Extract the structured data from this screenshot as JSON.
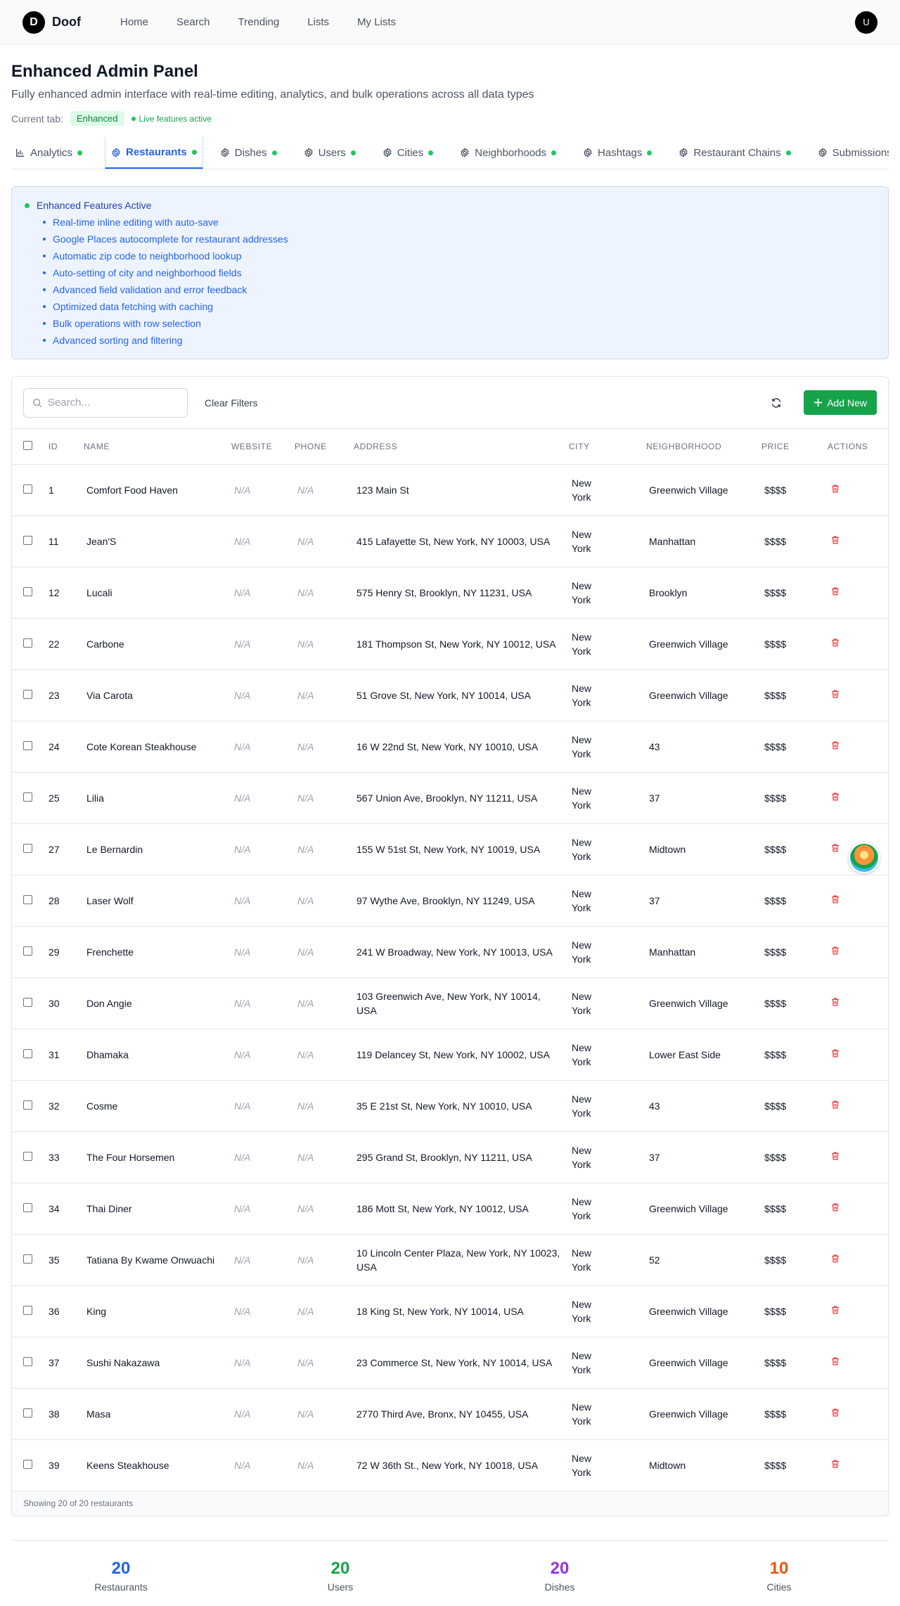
{
  "nav": {
    "logo_letter": "D",
    "brand": "Doof",
    "links": [
      "Home",
      "Search",
      "Trending",
      "Lists",
      "My Lists"
    ],
    "avatar_letter": "U"
  },
  "header": {
    "title": "Enhanced Admin Panel",
    "subtitle": "Fully enhanced admin interface with real-time editing, analytics, and bulk operations across all data types",
    "current_tab_label": "Current tab:",
    "current_tab_badge": "Enhanced",
    "live_label": "Live features active"
  },
  "tabs": [
    {
      "label": "Analytics",
      "icon": "chart-icon",
      "active": false
    },
    {
      "label": "Restaurants",
      "icon": "gear-icon",
      "active": true
    },
    {
      "label": "Dishes",
      "icon": "gear-icon",
      "active": false
    },
    {
      "label": "Users",
      "icon": "gear-icon",
      "active": false
    },
    {
      "label": "Cities",
      "icon": "gear-icon",
      "active": false
    },
    {
      "label": "Neighborhoods",
      "icon": "gear-icon",
      "active": false
    },
    {
      "label": "Hashtags",
      "icon": "gear-icon",
      "active": false
    },
    {
      "label": "Restaurant Chains",
      "icon": "gear-icon",
      "active": false
    },
    {
      "label": "Submissions",
      "icon": "gear-icon",
      "active": false
    }
  ],
  "features": {
    "title": "Enhanced Features Active",
    "items": [
      "Real-time inline editing with auto-save",
      "Google Places autocomplete for restaurant addresses",
      "Automatic zip code to neighborhood lookup",
      "Auto-setting of city and neighborhood fields",
      "Advanced field validation and error feedback",
      "Optimized data fetching with caching",
      "Bulk operations with row selection",
      "Advanced sorting and filtering"
    ]
  },
  "toolbar": {
    "search_placeholder": "Search...",
    "clear_filters": "Clear Filters",
    "add_new": "Add New"
  },
  "table": {
    "headers": [
      "ID",
      "NAME",
      "WEBSITE",
      "PHONE",
      "ADDRESS",
      "CITY",
      "NEIGHBORHOOD",
      "PRICE",
      "ACTIONS"
    ],
    "rows": [
      {
        "id": "1",
        "name": "Comfort Food Haven",
        "website": "N/A",
        "phone": "N/A",
        "address": "123 Main St",
        "city": "New York",
        "neighborhood": "Greenwich Village",
        "price": "$$$$"
      },
      {
        "id": "11",
        "name": "Jean'S",
        "website": "N/A",
        "phone": "N/A",
        "address": "415 Lafayette St, New York, NY 10003, USA",
        "city": "New York",
        "neighborhood": "Manhattan",
        "price": "$$$$"
      },
      {
        "id": "12",
        "name": "Lucali",
        "website": "N/A",
        "phone": "N/A",
        "address": "575 Henry St, Brooklyn, NY 11231, USA",
        "city": "New York",
        "neighborhood": "Brooklyn",
        "price": "$$$$"
      },
      {
        "id": "22",
        "name": "Carbone",
        "website": "N/A",
        "phone": "N/A",
        "address": "181 Thompson St, New York, NY 10012, USA",
        "city": "New York",
        "neighborhood": "Greenwich Village",
        "price": "$$$$"
      },
      {
        "id": "23",
        "name": "Via Carota",
        "website": "N/A",
        "phone": "N/A",
        "address": "51 Grove St, New York, NY 10014, USA",
        "city": "New York",
        "neighborhood": "Greenwich Village",
        "price": "$$$$"
      },
      {
        "id": "24",
        "name": "Cote Korean Steakhouse",
        "website": "N/A",
        "phone": "N/A",
        "address": "16 W 22nd St, New York, NY 10010, USA",
        "city": "New York",
        "neighborhood": "43",
        "price": "$$$$"
      },
      {
        "id": "25",
        "name": "Lilia",
        "website": "N/A",
        "phone": "N/A",
        "address": "567 Union Ave, Brooklyn, NY 11211, USA",
        "city": "New York",
        "neighborhood": "37",
        "price": "$$$$"
      },
      {
        "id": "27",
        "name": "Le Bernardin",
        "website": "N/A",
        "phone": "N/A",
        "address": "155 W 51st St, New York, NY 10019, USA",
        "city": "New York",
        "neighborhood": "Midtown",
        "price": "$$$$"
      },
      {
        "id": "28",
        "name": "Laser Wolf",
        "website": "N/A",
        "phone": "N/A",
        "address": "97 Wythe Ave, Brooklyn, NY 11249, USA",
        "city": "New York",
        "neighborhood": "37",
        "price": "$$$$"
      },
      {
        "id": "29",
        "name": "Frenchette",
        "website": "N/A",
        "phone": "N/A",
        "address": "241 W Broadway, New York, NY 10013, USA",
        "city": "New York",
        "neighborhood": "Manhattan",
        "price": "$$$$"
      },
      {
        "id": "30",
        "name": "Don Angie",
        "website": "N/A",
        "phone": "N/A",
        "address": "103 Greenwich Ave, New York, NY 10014, USA",
        "city": "New York",
        "neighborhood": "Greenwich Village",
        "price": "$$$$"
      },
      {
        "id": "31",
        "name": "Dhamaka",
        "website": "N/A",
        "phone": "N/A",
        "address": "119 Delancey St, New York, NY 10002, USA",
        "city": "New York",
        "neighborhood": "Lower East Side",
        "price": "$$$$"
      },
      {
        "id": "32",
        "name": "Cosme",
        "website": "N/A",
        "phone": "N/A",
        "address": "35 E 21st St, New York, NY 10010, USA",
        "city": "New York",
        "neighborhood": "43",
        "price": "$$$$"
      },
      {
        "id": "33",
        "name": "The Four Horsemen",
        "website": "N/A",
        "phone": "N/A",
        "address": "295 Grand St, Brooklyn, NY 11211, USA",
        "city": "New York",
        "neighborhood": "37",
        "price": "$$$$"
      },
      {
        "id": "34",
        "name": "Thai Diner",
        "website": "N/A",
        "phone": "N/A",
        "address": "186 Mott St, New York, NY 10012, USA",
        "city": "New York",
        "neighborhood": "Greenwich Village",
        "price": "$$$$"
      },
      {
        "id": "35",
        "name": "Tatiana By Kwame Onwuachi",
        "website": "N/A",
        "phone": "N/A",
        "address": "10 Lincoln Center Plaza, New York, NY 10023, USA",
        "city": "New York",
        "neighborhood": "52",
        "price": "$$$$"
      },
      {
        "id": "36",
        "name": "King",
        "website": "N/A",
        "phone": "N/A",
        "address": "18 King St, New York, NY 10014, USA",
        "city": "New York",
        "neighborhood": "Greenwich Village",
        "price": "$$$$"
      },
      {
        "id": "37",
        "name": "Sushi Nakazawa",
        "website": "N/A",
        "phone": "N/A",
        "address": "23 Commerce St, New York, NY 10014, USA",
        "city": "New York",
        "neighborhood": "Greenwich Village",
        "price": "$$$$"
      },
      {
        "id": "38",
        "name": "Masa",
        "website": "N/A",
        "phone": "N/A",
        "address": "2770 Third Ave, Bronx, NY 10455, USA",
        "city": "New York",
        "neighborhood": "Greenwich Village",
        "price": "$$$$"
      },
      {
        "id": "39",
        "name": "Keens Steakhouse",
        "website": "N/A",
        "phone": "N/A",
        "address": "72 W 36th St., New York, NY 10018, USA",
        "city": "New York",
        "neighborhood": "Midtown",
        "price": "$$$$"
      }
    ],
    "footer": "Showing 20 of 20 restaurants"
  },
  "stats": [
    {
      "value": "20",
      "label": "Restaurants",
      "color": "#2563eb"
    },
    {
      "value": "20",
      "label": "Users",
      "color": "#16a34a"
    },
    {
      "value": "20",
      "label": "Dishes",
      "color": "#9333ea"
    },
    {
      "value": "10",
      "label": "Cities",
      "color": "#ea580c"
    }
  ],
  "colors": {
    "accent": "#2563eb",
    "success": "#16a34a",
    "danger": "#ef4444"
  }
}
